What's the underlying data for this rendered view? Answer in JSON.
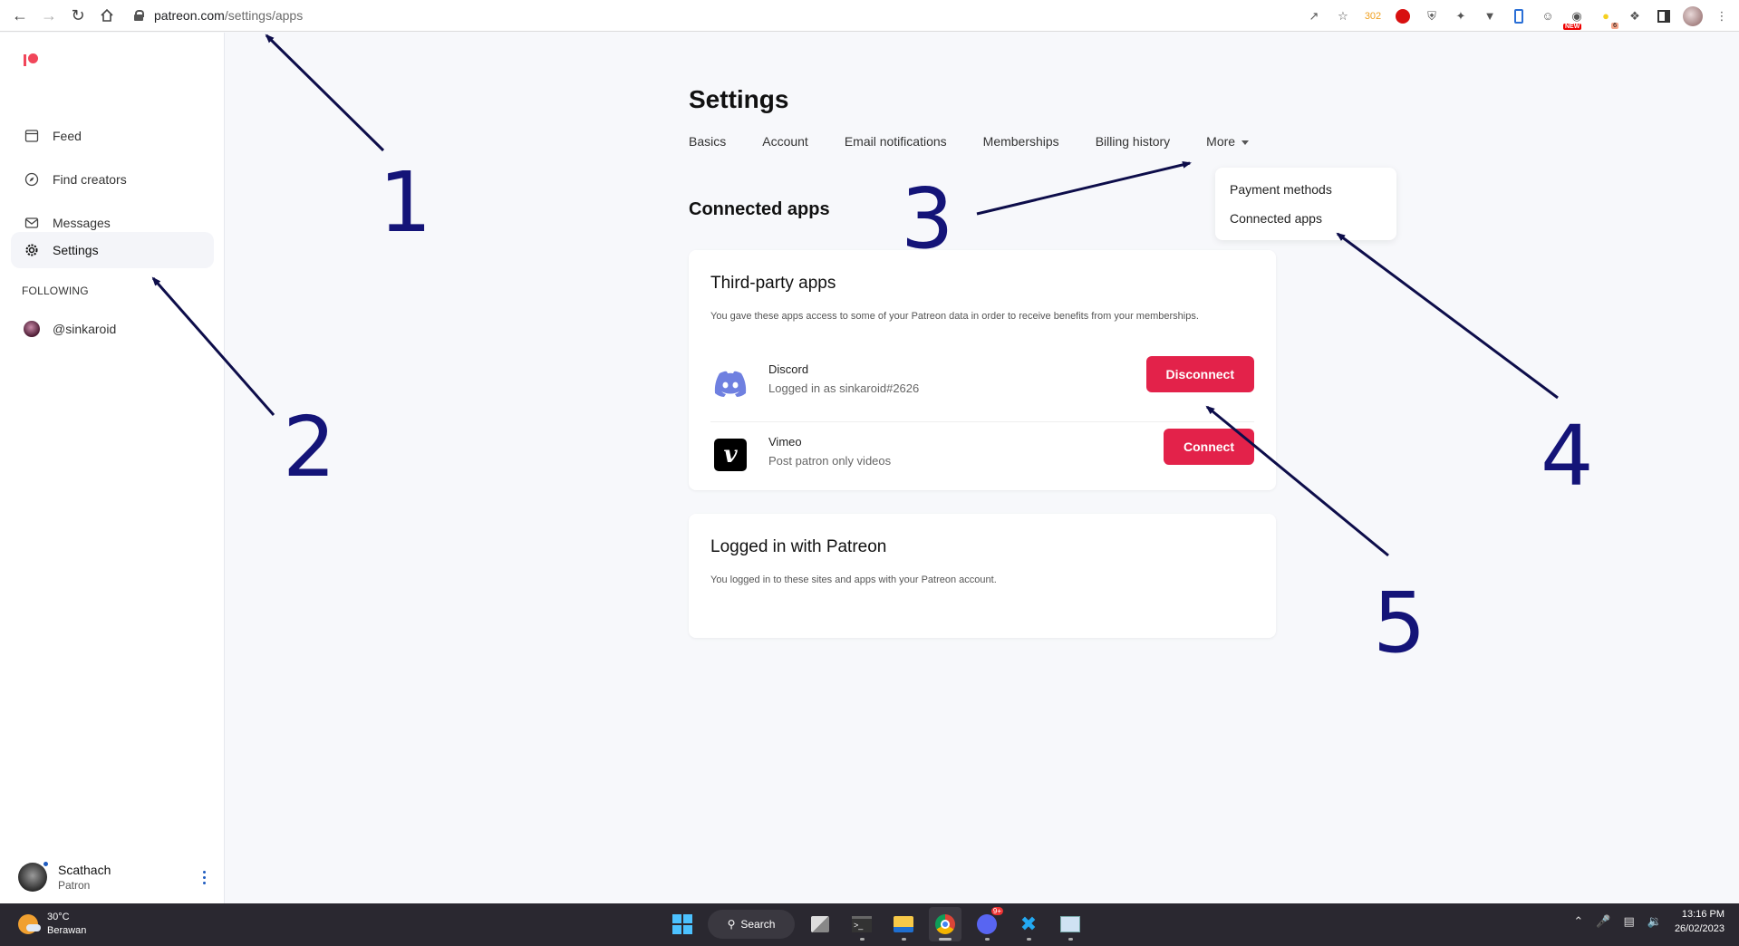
{
  "browser": {
    "url_host": "patreon.com",
    "url_path": "/settings/apps",
    "extension_counter": "302",
    "extension_new_badge": "NEW",
    "extension_number_badge": "6"
  },
  "sidebar": {
    "items": [
      {
        "label": "Feed",
        "icon": "feed-icon"
      },
      {
        "label": "Find creators",
        "icon": "compass-icon"
      },
      {
        "label": "Messages",
        "icon": "mail-icon"
      },
      {
        "label": "Settings",
        "icon": "gear-icon",
        "active": true
      }
    ],
    "following_label": "FOLLOWING",
    "following": [
      {
        "label": "@sinkaroid"
      }
    ],
    "user": {
      "name": "Scathach",
      "role": "Patron"
    }
  },
  "main": {
    "title": "Settings",
    "tabs": [
      {
        "label": "Basics"
      },
      {
        "label": "Account"
      },
      {
        "label": "Email notifications"
      },
      {
        "label": "Memberships"
      },
      {
        "label": "Billing history"
      },
      {
        "label": "More"
      }
    ],
    "more_menu": [
      {
        "label": "Payment methods"
      },
      {
        "label": "Connected apps"
      }
    ],
    "section_title": "Connected apps",
    "third_party": {
      "title": "Third-party apps",
      "description": "You gave these apps access to some of your Patreon data in order to receive benefits from your memberships.",
      "apps": [
        {
          "name": "Discord",
          "subtitle": "Logged in as sinkaroid#2626",
          "button": "Disconnect",
          "icon": "discord-icon"
        },
        {
          "name": "Vimeo",
          "subtitle": "Post patron only videos",
          "button": "Connect",
          "icon": "vimeo-icon"
        }
      ]
    },
    "logged_in": {
      "title": "Logged in with Patreon",
      "description": "You logged in to these sites and apps with your Patreon account."
    }
  },
  "annotations": [
    "1",
    "2",
    "3",
    "4",
    "5"
  ],
  "colors": {
    "brand": "#f1465a",
    "button": "#e3224a",
    "annotation": "#141478"
  },
  "taskbar": {
    "weather_temp": "30°C",
    "weather_desc": "Berawan",
    "search_label": "Search",
    "discord_badge": "9+",
    "time": "13:16 PM",
    "date": "26/02/2023"
  }
}
